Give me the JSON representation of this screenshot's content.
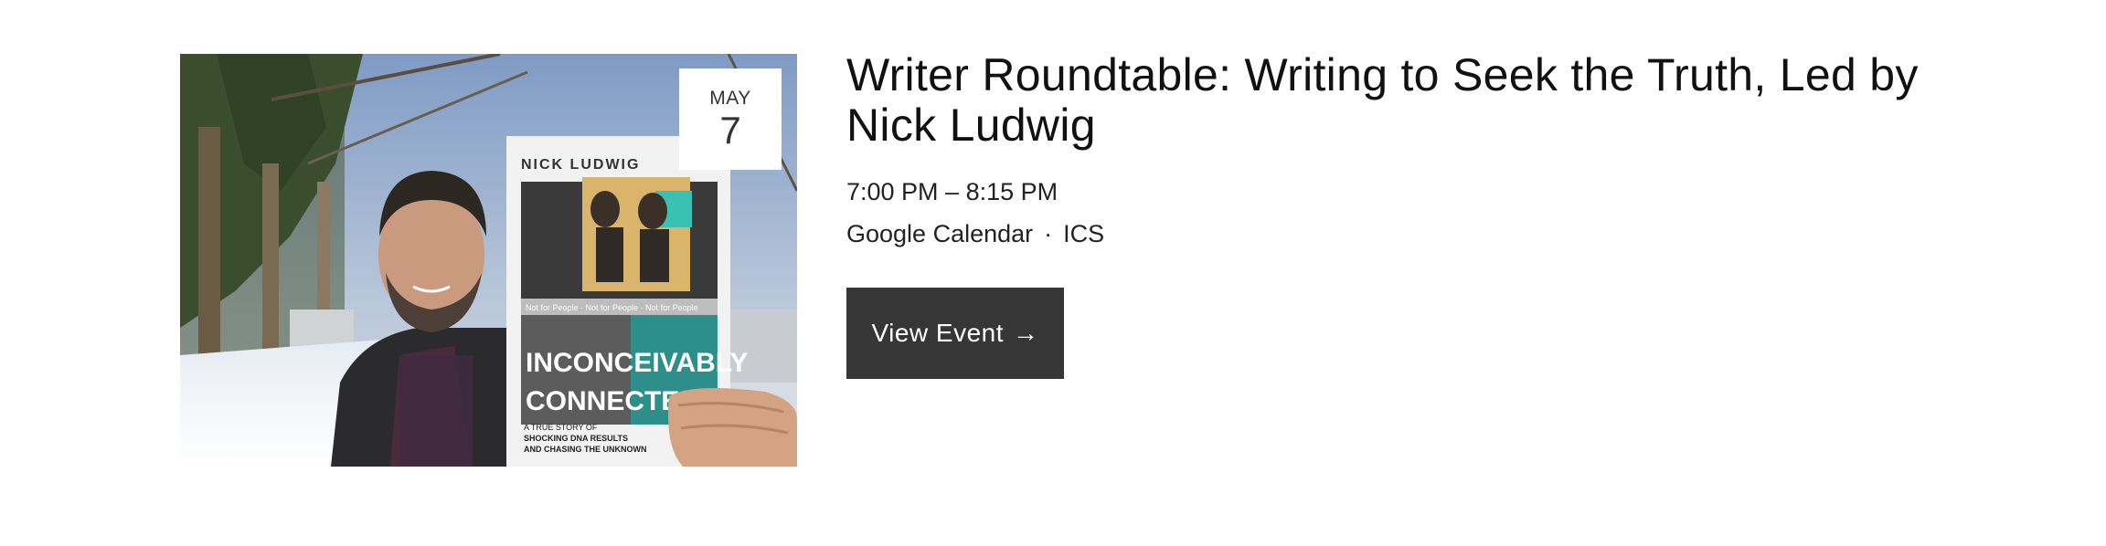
{
  "event": {
    "month": "MAY",
    "day": "7",
    "title": "Writer Roundtable: Writing to Seek the Truth, Led by Nick Ludwig",
    "time": "7:00 PM – 8:15 PM",
    "calendar_links": {
      "google": "Google Calendar",
      "separator": "·",
      "ics": "ICS"
    },
    "view_button": {
      "label": "View Event",
      "icon": "arrow-right-icon",
      "arrow": "→"
    }
  },
  "image": {
    "book_author": "NICK LUDWIG",
    "book_title_line1": "INCONCEIVABLY",
    "book_title_line2": "CONNECTED",
    "book_subtitle_line1": "A TRUE STORY OF",
    "book_subtitle_line2": "SHOCKING DNA RESULTS",
    "book_subtitle_line3": "AND CHASING THE UNKNOWN",
    "book_band_text": "Not for People · Not for People · Not for People"
  },
  "colors": {
    "button_bg": "#363636",
    "button_text": "#ffffff",
    "title_text": "#111111",
    "badge_bg": "#ffffff"
  }
}
